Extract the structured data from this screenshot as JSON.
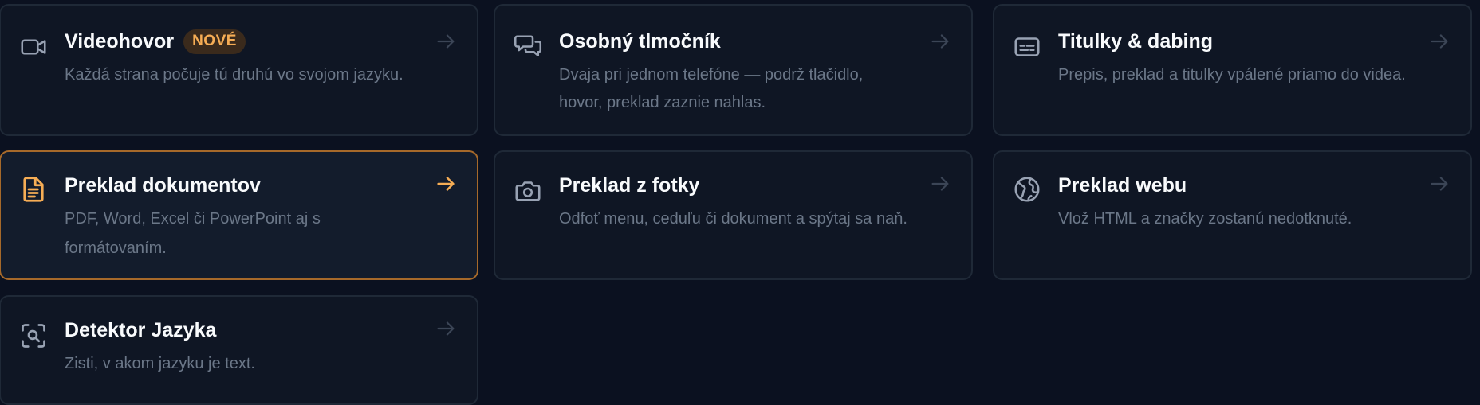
{
  "cards": [
    {
      "title": "Videohovor",
      "badge": "NOVÉ",
      "desc": "Každá strana počuje tú druhú vo svojom jazyku.",
      "icon": "video-camera-icon"
    },
    {
      "title": "Osobný tlmočník",
      "desc": "Dvaja pri jednom telefóne — podrž tlačidlo, hovor, preklad zaznie nahlas.",
      "icon": "chat-bubbles-icon"
    },
    {
      "title": "Titulky & dabing",
      "desc": "Prepis, preklad a titulky vpálené priamo do videa.",
      "icon": "subtitles-icon"
    },
    {
      "title": "Preklad dokumentov",
      "desc": "PDF, Word, Excel či PowerPoint aj s formátovaním.",
      "icon": "document-icon"
    },
    {
      "title": "Preklad z fotky",
      "desc": "Odfoť menu, ceduľu či dokument a spýtaj sa naň.",
      "icon": "camera-icon"
    },
    {
      "title": "Preklad webu",
      "desc": "Vlož HTML a značky zostanú nedotknuté.",
      "icon": "globe-icon"
    },
    {
      "title": "Detektor Jazyka",
      "desc": "Zisti, v akom jazyku je text.",
      "icon": "scan-search-icon"
    }
  ],
  "colors": {
    "accent": "#f6ad55",
    "background": "#0b1120",
    "card": "#0f1624",
    "border": "#1f2937"
  }
}
